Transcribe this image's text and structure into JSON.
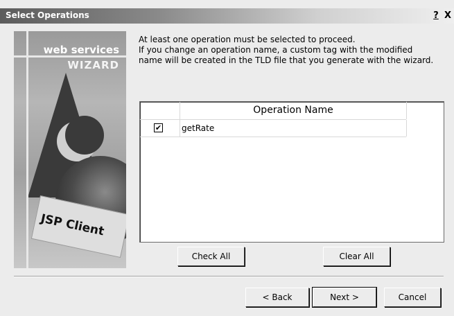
{
  "window": {
    "title": "Select Operations",
    "help_label": "?",
    "close_label": "X"
  },
  "banner": {
    "line1": "web services",
    "line2": "WIZARD",
    "card_label": "JSP Client"
  },
  "instructions": [
    "At least one operation must be selected to proceed.",
    "If you change an operation name, a custom tag with the modified",
    "name will be created in the TLD file that you generate with the wizard."
  ],
  "table": {
    "column_header": "Operation Name",
    "rows": [
      {
        "checked": true,
        "check_glyph": "✔",
        "name": "getRate"
      }
    ]
  },
  "buttons": {
    "check_all": "Check All",
    "clear_all": "Clear All",
    "back": "< Back",
    "next": "Next >",
    "cancel": "Cancel"
  }
}
